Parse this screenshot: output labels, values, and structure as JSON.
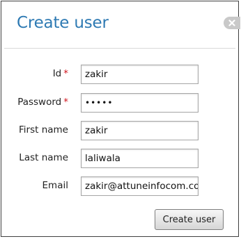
{
  "dialog": {
    "title": "Create user",
    "close_icon": "close-icon"
  },
  "form": {
    "required_marker": "*",
    "id": {
      "label": "Id",
      "value": "zakir",
      "required": true
    },
    "password": {
      "label": "Password",
      "value": "•••••",
      "required": true
    },
    "first_name": {
      "label": "First name",
      "value": "zakir"
    },
    "last_name": {
      "label": "Last name",
      "value": "laliwala"
    },
    "email": {
      "label": "Email",
      "value": "zakir@attuneinfocom.com"
    }
  },
  "actions": {
    "submit_label": "Create user"
  },
  "colors": {
    "title": "#2e7ab3",
    "required": "#d0141d",
    "border": "#3f3f3f"
  }
}
